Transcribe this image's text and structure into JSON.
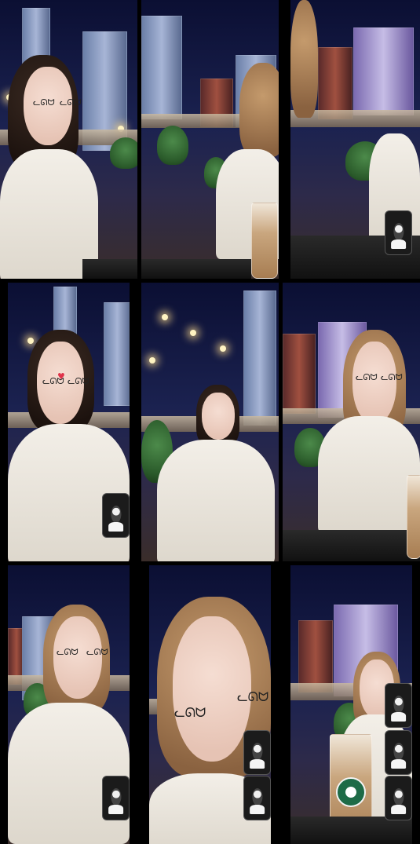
{
  "page": {
    "layout": "3x3 video call grid"
  },
  "tiles": [
    {
      "scene": "city-night-terrace",
      "subject": "dark-hair"
    },
    {
      "scene": "city-night-terrace",
      "subject": "blonde-hair"
    },
    {
      "scene": "city-night-terrace",
      "subject": "blonde-hair"
    },
    {
      "scene": "city-night-terrace",
      "subject": "dark-hair"
    },
    {
      "scene": "city-night-terrace",
      "subject": "dark-hair"
    },
    {
      "scene": "city-night-terrace",
      "subject": "blonde-hair"
    },
    {
      "scene": "city-night-terrace",
      "subject": "blonde-hair"
    },
    {
      "scene": "city-night-terrace",
      "subject": "blonde-hair"
    },
    {
      "scene": "city-night-terrace",
      "subject": "blonde-hair"
    }
  ],
  "icons": {
    "sticker": "cat-face-sticker",
    "heart": "heart-icon",
    "pip": "video-thumbnail-icon",
    "cup_logo": "coffee-logo-icon"
  },
  "colors": {
    "sky_top": "#0b0f33",
    "accent_lights": "#ffd98a",
    "logo_green": "#1e6b47"
  }
}
